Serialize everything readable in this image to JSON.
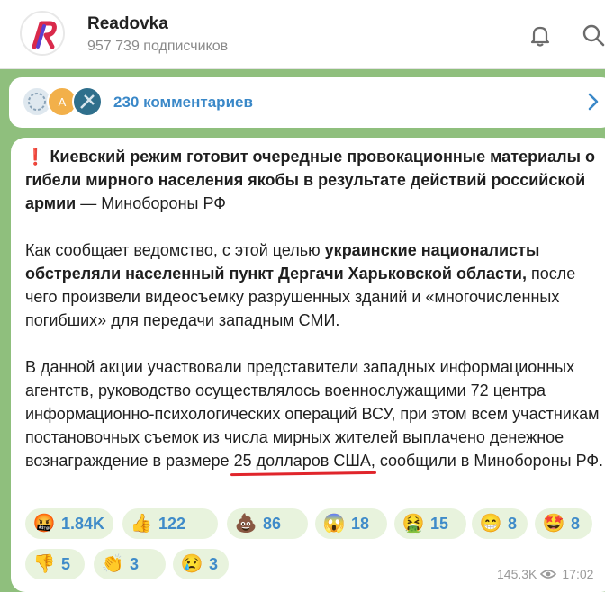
{
  "header": {
    "channel_name": "Readovka",
    "subscribers": "957 739 подписчиков"
  },
  "comments": {
    "label": "230 комментариев"
  },
  "message": {
    "p1_excl": "❗",
    "p1_bold": "Киевский режим готовит очередные провокационные материалы о гибели мирного населения якобы в результате действий российской армии",
    "p1_tail": " — Минобороны РФ",
    "p2_start": "Как сообщает ведомство, с этой целью ",
    "p2_bold": "украинские националисты обстреляли населенный пункт Дергачи Харьковской области,",
    "p2_tail": " после чего произвели видеосъемку разрушенных зданий и «многочисленных погибших» для передачи западным СМИ.",
    "p3_start": "В данной акции участвовали представители западных информационных агентств, руководство осуществлялось военнослужащими 72 центра информационно-психологических операций ВСУ, при этом всем участникам постановочных съемок из числа мирных жителей выплачено денежное вознаграждение в размере ",
    "p3_underlined": "25 долларов США",
    "p3_tail": ", сообщили в Минобороны РФ."
  },
  "reactions": [
    {
      "emoji": "🤬",
      "count": "1.84K",
      "icon": "angry-face-icon"
    },
    {
      "emoji": "👍",
      "count": "122",
      "icon": "thumbs-up-icon"
    },
    {
      "emoji": "💩",
      "count": "86",
      "icon": "poop-icon"
    },
    {
      "emoji": "😱",
      "count": "18",
      "icon": "screaming-face-icon"
    },
    {
      "emoji": "🤮",
      "count": "15",
      "icon": "vomiting-face-icon"
    },
    {
      "emoji": "😁",
      "count": "8",
      "icon": "grinning-face-icon"
    },
    {
      "emoji": "🤩",
      "count": "8",
      "icon": "star-struck-icon"
    },
    {
      "emoji": "👎",
      "count": "5",
      "icon": "thumbs-down-icon"
    },
    {
      "emoji": "👏",
      "count": "3",
      "icon": "clapping-icon"
    },
    {
      "emoji": "😢",
      "count": "3",
      "icon": "crying-face-icon"
    }
  ],
  "meta": {
    "views": "145.3K",
    "time": "17:02"
  },
  "colors": {
    "background": "#8fbf7d",
    "link": "#3a88c8",
    "accent_red": "#e0252b",
    "reaction_bg": "#e8f3dd"
  }
}
